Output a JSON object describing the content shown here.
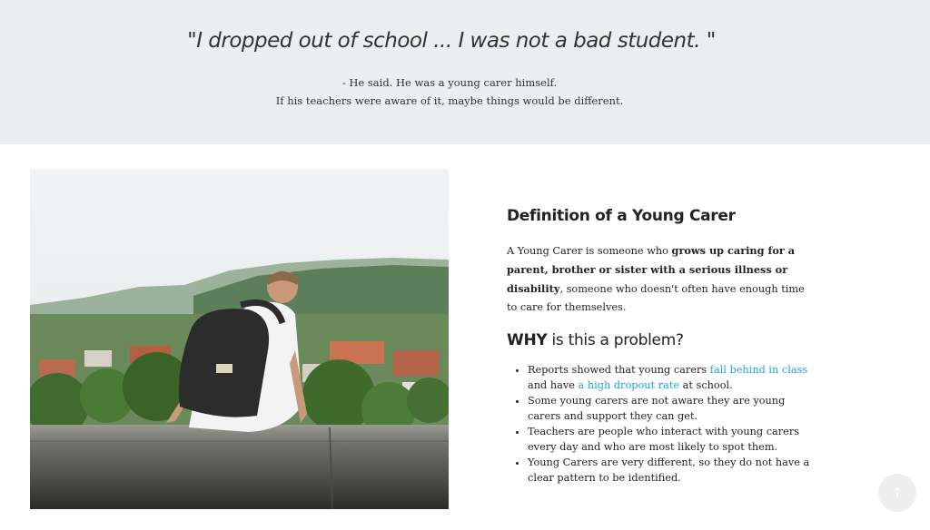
{
  "hero": {
    "quote": "\"I dropped out of school ... I was not a bad student. \"",
    "attribution_line1": "- He said. He was a young carer himself.",
    "attribution_line2": "If his teachers were aware of it, maybe things would be different."
  },
  "definition": {
    "heading": "Definition of a Young Carer",
    "text_before": "A Young Carer is someone who ",
    "text_bold": "grows up caring for a parent, brother or sister with a serious illness or disability",
    "text_after": ", someone who doesn't often have enough time to care for themselves."
  },
  "why": {
    "heading_bold": "WHY",
    "heading_rest": " is this a problem?",
    "bullets": [
      {
        "part1": "Reports showed that young carers ",
        "link1": "fall behind in class",
        "part2": " and have ",
        "link2": "a high dropout rate",
        "part3": " at school."
      },
      {
        "text": "Some young carers are not aware they are young carers and support they can get."
      },
      {
        "text": "Teachers are people who interact with young carers every day and who are most likely to spot them."
      },
      {
        "text": "Young Carers are very different, so they do not have a clear pattern to be identified."
      }
    ]
  },
  "colors": {
    "hero_bg": "#eaeff0",
    "link": "#21a0e0",
    "back_to_top_bg": "#eeeeee"
  },
  "icons": {
    "back_to_top": "arrow-up-icon",
    "back_to_top_glyph": "↑"
  }
}
